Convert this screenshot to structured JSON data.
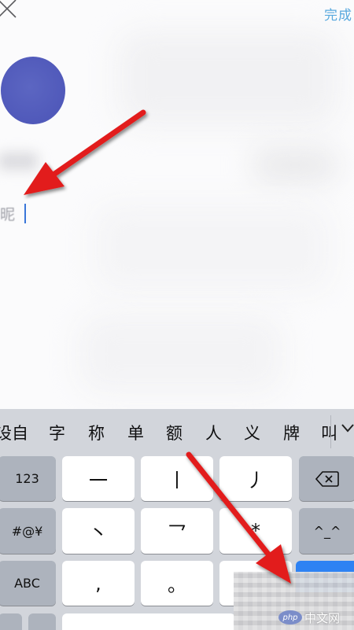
{
  "header": {
    "done_label": "完成"
  },
  "profile": {
    "name_value": "昵"
  },
  "keyboard": {
    "candidates": [
      "设自",
      "字",
      "称",
      "单",
      "额",
      "人",
      "义",
      "牌",
      "叫"
    ],
    "rows": [
      {
        "func": "123",
        "keys": [
          "一",
          "丨",
          "丿"
        ],
        "right": "delete"
      },
      {
        "func": "#@¥",
        "keys": [
          "丶",
          "乛",
          "*"
        ],
        "right": "^^"
      },
      {
        "func": "ABC",
        "keys": [
          ",",
          "。",
          ""
        ],
        "right": ""
      }
    ],
    "right_row2_label": "^_^"
  },
  "watermark": {
    "logo": "php",
    "text": "中文网"
  }
}
